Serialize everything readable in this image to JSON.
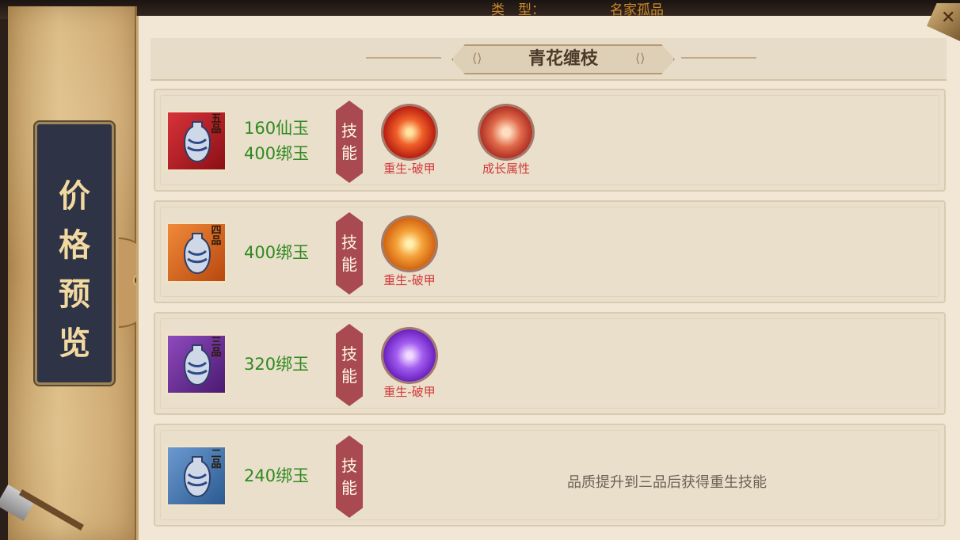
{
  "title": "青花缠枝",
  "side_label": [
    "价",
    "格",
    "预",
    "览"
  ],
  "skill_tag": "技能",
  "rows": [
    {
      "grade": "五品",
      "quality_color": "#c8202a",
      "prices": [
        "160仙玉",
        "400绑玉"
      ],
      "skills": [
        {
          "label": "重生-破甲",
          "icon": "phoenix-red-icon"
        },
        {
          "label": "成长属性",
          "icon": "growth-figure-icon"
        }
      ]
    },
    {
      "grade": "四品",
      "quality_color": "#e8702a",
      "prices": [
        "400绑玉"
      ],
      "skills": [
        {
          "label": "重生-破甲",
          "icon": "phoenix-orange-icon"
        }
      ]
    },
    {
      "grade": "三品",
      "quality_color": "#7a3aa8",
      "prices": [
        "320绑玉"
      ],
      "skills": [
        {
          "label": "重生-破甲",
          "icon": "phoenix-purple-icon"
        }
      ]
    },
    {
      "grade": "二品",
      "quality_color": "#4a7ab8",
      "prices": [
        "240绑玉"
      ],
      "skills": [],
      "note": "品质提升到三品后获得重生技能"
    }
  ]
}
